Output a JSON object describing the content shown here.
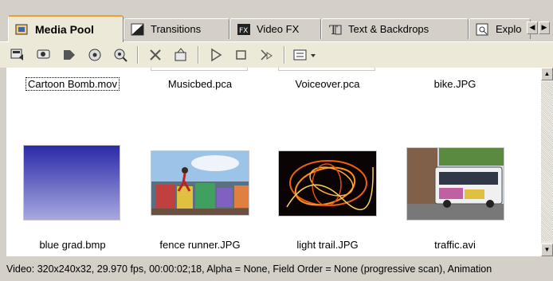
{
  "tabs": [
    {
      "label": "Media Pool",
      "icon": "media-pool-icon",
      "active": true
    },
    {
      "label": "Transitions",
      "icon": "transitions-icon",
      "active": false
    },
    {
      "label": "Video FX",
      "icon": "video-fx-icon",
      "active": false
    },
    {
      "label": "Text & Backdrops",
      "icon": "text-backdrops-icon",
      "active": false
    },
    {
      "label": "Explo",
      "icon": "explorer-icon",
      "active": false
    }
  ],
  "toolbar": {
    "buttons": [
      "import-media-icon",
      "capture-video-icon",
      "get-media-web-icon",
      "get-photo-icon",
      "media-properties-search-icon",
      "delete-icon",
      "properties-icon",
      "play-icon",
      "stop-icon",
      "auto-preview-icon",
      "views-icon"
    ]
  },
  "media": {
    "row1": [
      "Cartoon Bomb.mov",
      "Musicbed.pca",
      "Voiceover.pca",
      "bike.JPG"
    ],
    "row2": [
      "blue grad.bmp",
      "fence runner.JPG",
      "light trail.JPG",
      "traffic.avi"
    ]
  },
  "status": {
    "text": "Video: 320x240x32, 29.970 fps, 00:00:02;18, Alpha = None, Field Order = None (progressive scan), Animation"
  },
  "colors": {
    "accent": "#e8a030",
    "gradient_top": "#2a2aa8",
    "gradient_bottom": "#a8a8e0"
  }
}
